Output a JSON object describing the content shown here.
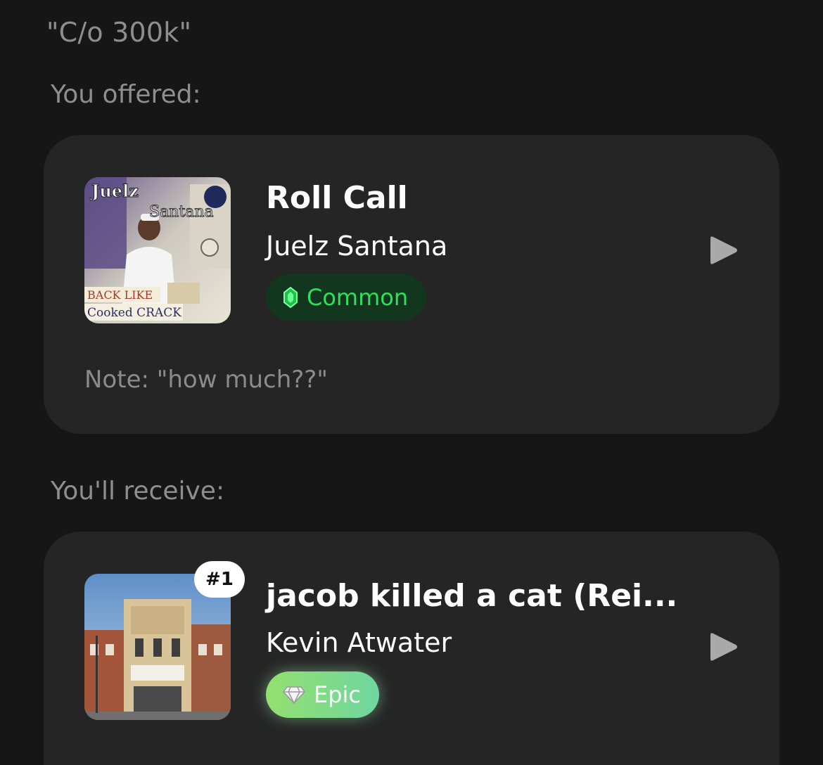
{
  "header": {
    "quote": "\"C/o 300k\""
  },
  "offered": {
    "label": "You offered:",
    "track": {
      "title": "Roll Call",
      "artist": "Juelz Santana",
      "rarity": "Common",
      "rarity_icon": "emerald-gem-icon",
      "note": "Note: \"how much??\"",
      "cover_text_top": "Juelz Santana",
      "cover_text_bottom": "Back Like Cooked Crack"
    }
  },
  "receive": {
    "label": "You'll receive:",
    "track": {
      "rank": "#1",
      "title": "jacob killed a cat (Rei...",
      "artist": "Kevin Atwater",
      "rarity": "Epic",
      "rarity_icon": "diamond-icon"
    }
  },
  "colors": {
    "background": "#161616",
    "card": "#252525",
    "common": "#2ee05a",
    "epic_start": "#93e06e",
    "epic_end": "#6fd6a0"
  }
}
